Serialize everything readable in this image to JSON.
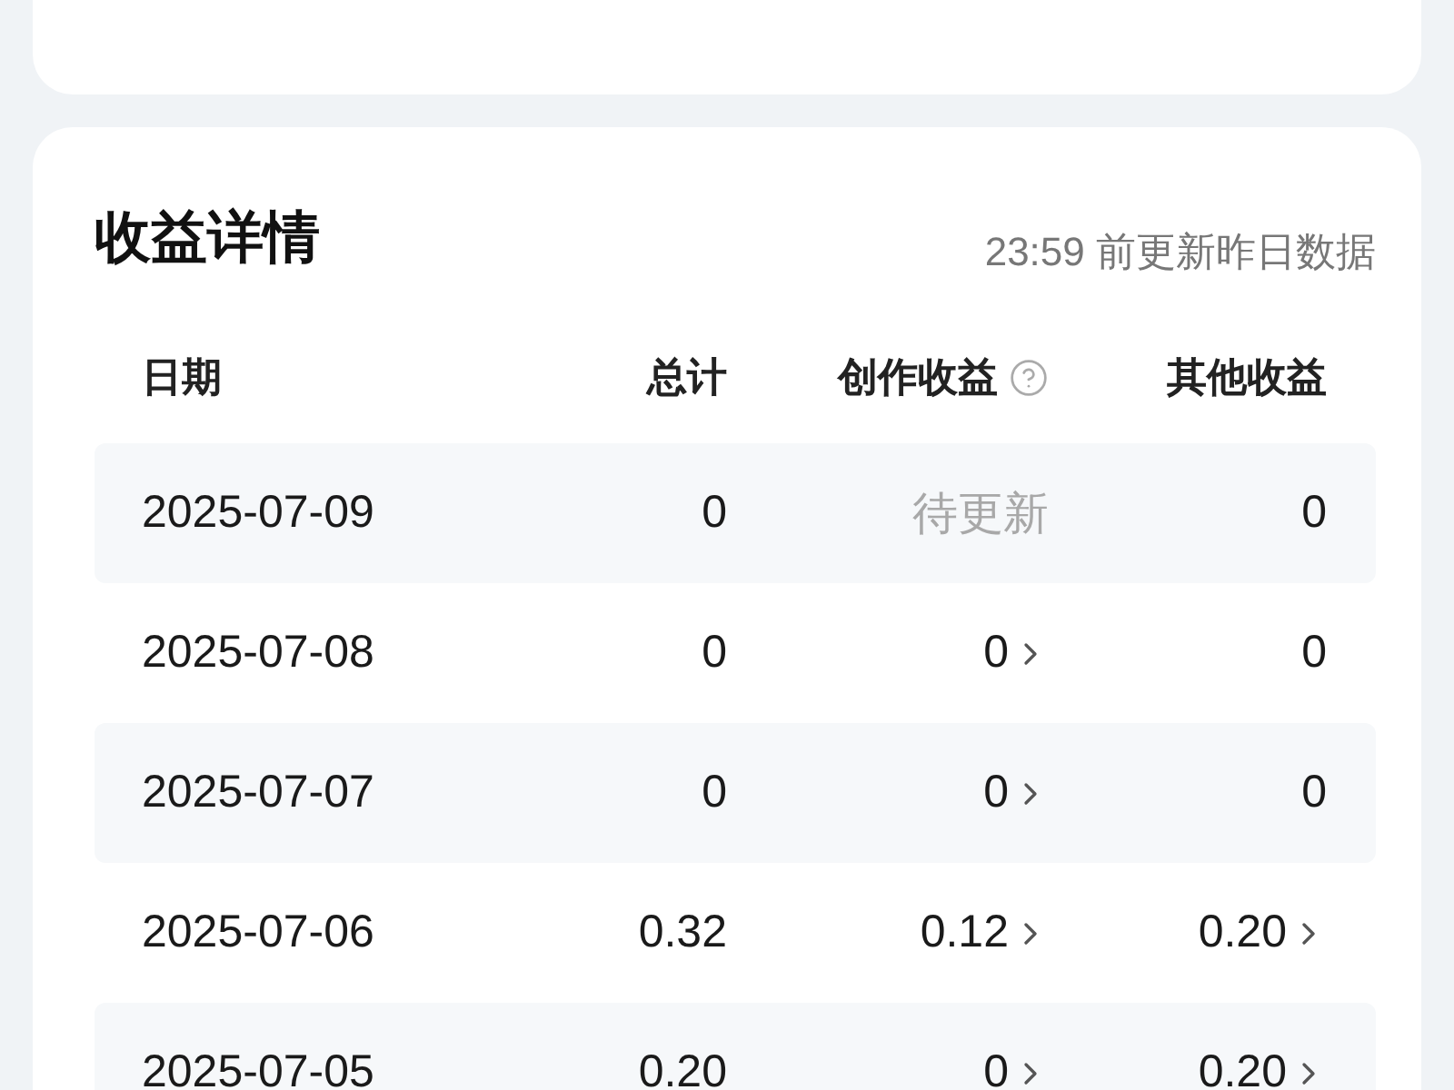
{
  "section": {
    "title": "收益详情",
    "update_note": "23:59 前更新昨日数据"
  },
  "table": {
    "columns": [
      {
        "label": "日期",
        "help": false
      },
      {
        "label": "总计",
        "help": false
      },
      {
        "label": "创作收益",
        "help": true
      },
      {
        "label": "其他收益",
        "help": false
      }
    ],
    "rows": [
      {
        "cells": [
          {
            "text": "2025-07-09",
            "kind": "date",
            "has_detail": false
          },
          {
            "text": "0",
            "kind": "value",
            "has_detail": false
          },
          {
            "text": "待更新",
            "kind": "pending",
            "has_detail": false
          },
          {
            "text": "0",
            "kind": "value",
            "has_detail": false
          }
        ]
      },
      {
        "cells": [
          {
            "text": "2025-07-08",
            "kind": "date",
            "has_detail": false
          },
          {
            "text": "0",
            "kind": "value",
            "has_detail": false
          },
          {
            "text": "0",
            "kind": "value",
            "has_detail": true
          },
          {
            "text": "0",
            "kind": "value",
            "has_detail": false
          }
        ]
      },
      {
        "cells": [
          {
            "text": "2025-07-07",
            "kind": "date",
            "has_detail": false
          },
          {
            "text": "0",
            "kind": "value",
            "has_detail": false
          },
          {
            "text": "0",
            "kind": "value",
            "has_detail": true
          },
          {
            "text": "0",
            "kind": "value",
            "has_detail": false
          }
        ]
      },
      {
        "cells": [
          {
            "text": "2025-07-06",
            "kind": "date",
            "has_detail": false
          },
          {
            "text": "0.32",
            "kind": "value",
            "has_detail": false
          },
          {
            "text": "0.12",
            "kind": "value",
            "has_detail": true
          },
          {
            "text": "0.20",
            "kind": "value",
            "has_detail": true
          }
        ]
      },
      {
        "cells": [
          {
            "text": "2025-07-05",
            "kind": "date",
            "has_detail": false
          },
          {
            "text": "0.20",
            "kind": "value",
            "has_detail": false
          },
          {
            "text": "0",
            "kind": "value",
            "has_detail": true
          },
          {
            "text": "0.20",
            "kind": "value",
            "has_detail": true
          }
        ]
      }
    ]
  }
}
